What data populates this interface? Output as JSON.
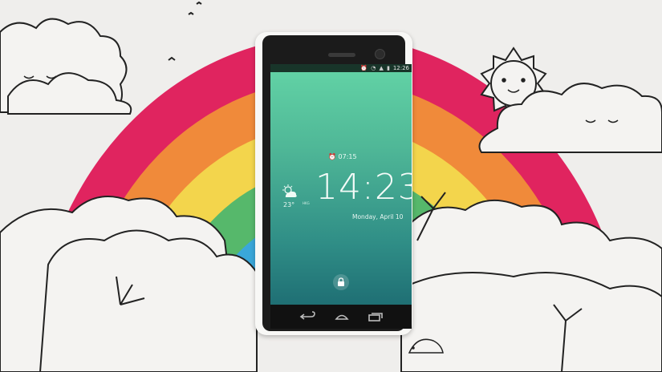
{
  "status_bar": {
    "time": "12:26",
    "icons": [
      "alarm-icon",
      "wifi-icon",
      "signal-icon",
      "battery-icon"
    ]
  },
  "lockscreen": {
    "alarm_time": "07:15",
    "clock": "14:23",
    "date": "Monday, April 10",
    "weather": {
      "temperature": "23°",
      "unit": "HKG",
      "condition_icon": "partly-cloudy-icon"
    },
    "unlock_icon": "lock-icon"
  },
  "nav_bar": {
    "buttons": [
      "back-icon",
      "home-icon",
      "recent-apps-icon"
    ]
  },
  "colors": {
    "background": "#efeeec",
    "rainbow": [
      "#e0245f",
      "#f08a3a",
      "#f3d54c",
      "#56b86b",
      "#3aa7d9"
    ],
    "screen_top": "#63d4a6",
    "screen_bottom": "#1f6f74"
  }
}
